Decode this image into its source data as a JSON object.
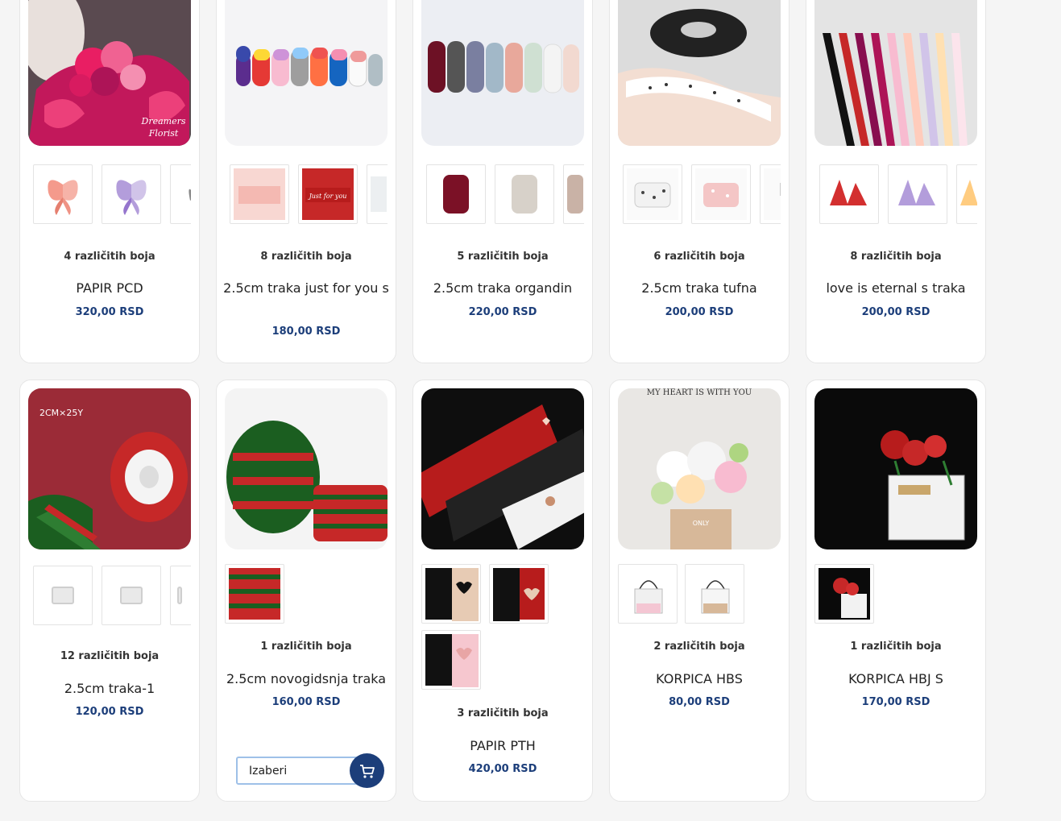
{
  "products": [
    {
      "colors": "4 različitih boja",
      "title": "PAPIR PCD",
      "price": "320,00 RSD",
      "main_image": "pink bouquet wrapped in butterfly paper with Dreamers Florist text"
    },
    {
      "colors": "8 različitih boja",
      "title": "2.5cm traka just for you s",
      "price": "180,00 RSD",
      "main_image": "row of colorful ribbon spools"
    },
    {
      "colors": "5 različitih boja",
      "title": "2.5cm traka organdin",
      "price": "220,00 RSD",
      "main_image": "row of sheer organza ribbon spools"
    },
    {
      "colors": "6 različitih boja",
      "title": "2.5cm traka tufna",
      "price": "200,00 RSD",
      "main_image": "dotted ribbon spools"
    },
    {
      "colors": "8 različitih boja",
      "title": "love is eternal s traka",
      "price": "200,00 RSD",
      "main_image": "printed love ribbons hanging"
    },
    {
      "colors": "12 različitih boja",
      "title": "2.5cm traka-1",
      "price": "120,00 RSD",
      "main_image": "green red christmas ribbon spool"
    },
    {
      "colors": "1 različitih boja",
      "title": "2.5cm novogidsnja traka",
      "price": "160,00 RSD",
      "main_image": "green red striped christmas ribbon rolls"
    },
    {
      "colors": "3 različitih boja",
      "title": "PAPIR PTH",
      "price": "420,00 RSD",
      "main_image": "black and white wrapping paper with hearts"
    },
    {
      "colors": "2 različitih boja",
      "title": "KORPICA HBS",
      "price": "80,00 RSD",
      "main_image": "flower box held in front of face"
    },
    {
      "colors": "1 različitih boja",
      "title": "KORPICA HBJ S",
      "price": "170,00 RSD",
      "main_image": "clear bag with red roses on black background"
    }
  ],
  "select": {
    "label": "Izaberi"
  },
  "colors": {
    "price": "#1c3e7a",
    "accent": "#1c3e7a",
    "border": "#e6e6e6"
  }
}
